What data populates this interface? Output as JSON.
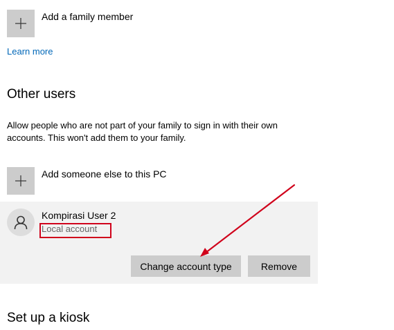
{
  "family": {
    "add_label": "Add a family member",
    "learn_more": "Learn more"
  },
  "other_users": {
    "title": "Other users",
    "description": "Allow people who are not part of your family to sign in with their own accounts. This won't add them to your family.",
    "add_label": "Add someone else to this PC",
    "user": {
      "name": "Kompirasi User 2",
      "account_type": "Local account",
      "change_button": "Change account type",
      "remove_button": "Remove"
    }
  },
  "kiosk": {
    "title": "Set up a kiosk"
  },
  "annotation": {
    "color": "#d0021b"
  },
  "icons": {
    "add": "plus-icon",
    "user": "person-icon"
  }
}
